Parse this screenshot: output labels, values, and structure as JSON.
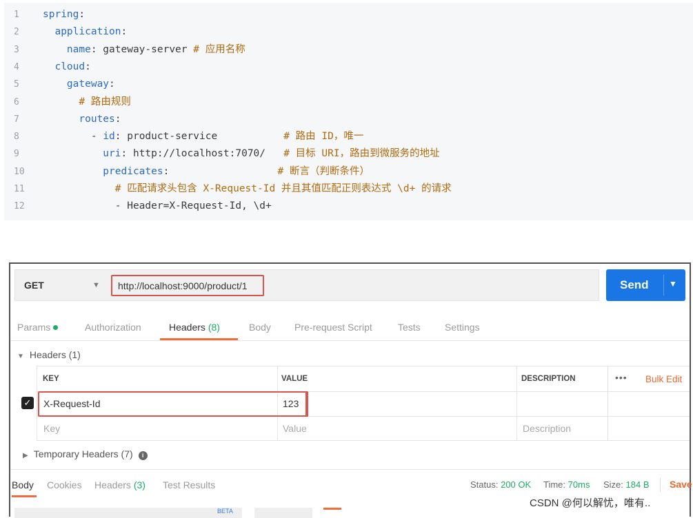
{
  "code": {
    "lines": [
      {
        "n": "1",
        "parts": [
          {
            "t": "spring",
            "c": "k"
          },
          {
            "t": ":",
            "c": "v"
          }
        ]
      },
      {
        "n": "2",
        "parts": [
          {
            "t": "  application",
            "c": "k"
          },
          {
            "t": ":",
            "c": "v"
          }
        ]
      },
      {
        "n": "3",
        "parts": [
          {
            "t": "    name",
            "c": "k"
          },
          {
            "t": ": gateway-server ",
            "c": "v"
          },
          {
            "t": "# 应用名称",
            "c": "c"
          }
        ]
      },
      {
        "n": "4",
        "parts": [
          {
            "t": "  cloud",
            "c": "k"
          },
          {
            "t": ":",
            "c": "v"
          }
        ]
      },
      {
        "n": "5",
        "parts": [
          {
            "t": "    gateway",
            "c": "k"
          },
          {
            "t": ":",
            "c": "v"
          }
        ]
      },
      {
        "n": "6",
        "parts": [
          {
            "t": "      # 路由规则",
            "c": "c"
          }
        ]
      },
      {
        "n": "7",
        "parts": [
          {
            "t": "      routes",
            "c": "k"
          },
          {
            "t": ":",
            "c": "v"
          }
        ]
      },
      {
        "n": "8",
        "parts": [
          {
            "t": "        - ",
            "c": "v"
          },
          {
            "t": "id",
            "c": "k"
          },
          {
            "t": ": product-service           ",
            "c": "v"
          },
          {
            "t": "# 路由 ID，唯一",
            "c": "c"
          }
        ]
      },
      {
        "n": "9",
        "parts": [
          {
            "t": "          uri",
            "c": "k"
          },
          {
            "t": ": http://localhost:7070/   ",
            "c": "v"
          },
          {
            "t": "# 目标 URI，路由到微服务的地址",
            "c": "c"
          }
        ]
      },
      {
        "n": "10",
        "parts": [
          {
            "t": "          predicates",
            "c": "k"
          },
          {
            "t": ":                  ",
            "c": "v"
          },
          {
            "t": "# 断言（判断条件）",
            "c": "c"
          }
        ]
      },
      {
        "n": "11",
        "parts": [
          {
            "t": "            # 匹配请求头包含 X-Request-Id 并且其值匹配正则表达式 \\d+ 的请求",
            "c": "c"
          }
        ]
      },
      {
        "n": "12",
        "parts": [
          {
            "t": "            - Header=X-Request-Id, \\d+",
            "c": "v"
          }
        ]
      }
    ]
  },
  "request": {
    "method": "GET",
    "url": "http://localhost:9000/product/1",
    "send_label": "Send"
  },
  "tabs": {
    "params": "Params",
    "authorization": "Authorization",
    "headers": "Headers",
    "headers_count": "(8)",
    "body": "Body",
    "prerequest": "Pre-request Script",
    "tests": "Tests",
    "settings": "Settings"
  },
  "headers_section": {
    "title": "Headers",
    "count": "(1)",
    "col_key": "KEY",
    "col_value": "VALUE",
    "col_description": "DESCRIPTION",
    "bulk_edit": "Bulk Edit",
    "more": "•••",
    "row_key": "X-Request-Id",
    "row_value": "123",
    "placeholder_key": "Key",
    "placeholder_value": "Value",
    "placeholder_description": "Description"
  },
  "temporary_headers": {
    "title": "Temporary Headers",
    "count": "(7)",
    "info": "i"
  },
  "response": {
    "tab_body": "Body",
    "tab_cookies": "Cookies",
    "tab_headers": "Headers",
    "tab_headers_count": "(3)",
    "tab_test_results": "Test Results",
    "status_label": "Status:",
    "status_value": "200 OK",
    "time_label": "Time:",
    "time_value": "70ms",
    "size_label": "Size:",
    "size_value": "184 B",
    "save": "Save",
    "beta": "BETA"
  },
  "watermark": "CSDN @何以解忧，唯有.."
}
